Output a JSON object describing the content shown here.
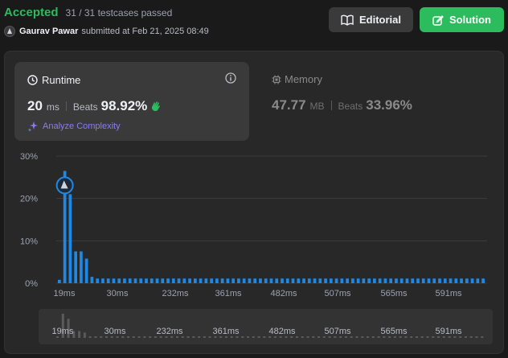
{
  "header": {
    "status": "Accepted",
    "testcases": "31 / 31 testcases passed",
    "user_name": "Gaurav Pawar",
    "submitted_text": "submitted at Feb 21, 2025 08:49",
    "editorial_label": "Editorial",
    "solution_label": "Solution"
  },
  "runtime": {
    "title": "Runtime",
    "value": "20",
    "unit": "ms",
    "beats_label": "Beats",
    "beats_value": "98.92%",
    "analyze_label": "Analyze Complexity"
  },
  "memory": {
    "title": "Memory",
    "value": "47.77",
    "unit": "MB",
    "beats_label": "Beats",
    "beats_value": "33.96%"
  },
  "colors": {
    "accent_green": "#2cbb5d",
    "bar_blue": "#1e88e5",
    "analyze_purple": "#8b7cf6"
  },
  "chart_data": {
    "type": "bar",
    "y_ticks": [
      "30%",
      "20%",
      "10%",
      "0%"
    ],
    "ylim": [
      0,
      30
    ],
    "x_tick_labels": [
      "19ms",
      "30ms",
      "232ms",
      "361ms",
      "482ms",
      "507ms",
      "565ms",
      "591ms"
    ],
    "values": [
      0.8,
      26.5,
      21,
      7.5,
      7.5,
      5.8,
      1.5,
      1.1,
      1.1,
      1.1,
      1.1,
      1.1,
      1.1,
      1.1,
      1.1,
      1.1,
      1.1,
      1.1,
      1.1,
      1.1,
      1.1,
      1.1,
      1.1,
      1.1,
      1.1,
      1.1,
      1.1,
      1.1,
      1.1,
      1.1,
      1.1,
      1.1,
      1.1,
      1.1,
      1.1,
      1.1,
      1.1,
      1.1,
      1.1,
      1.1,
      1.1,
      1.1,
      1.1,
      1.1,
      1.1,
      1.1,
      1.1,
      1.1,
      1.1,
      1.1,
      1.1,
      1.1,
      1.1,
      1.1,
      1.1,
      1.1,
      1.1,
      1.1,
      1.1,
      1.1,
      1.1,
      1.1,
      1.1,
      1.1,
      1.1,
      1.1,
      1.1,
      1.1,
      1.1,
      1.1,
      1.1,
      1.1,
      1.1,
      1.1,
      1.1,
      1.1,
      1.1,
      1.1,
      1.1
    ],
    "highlight_index": 1,
    "grid": true
  }
}
